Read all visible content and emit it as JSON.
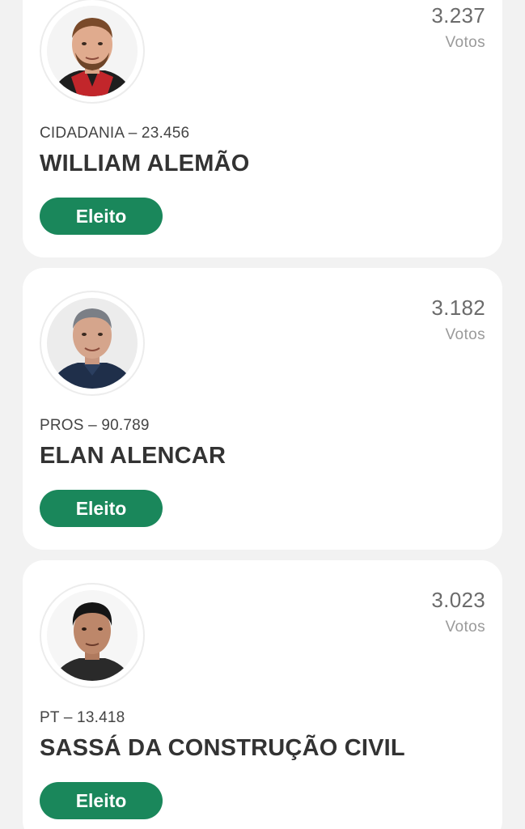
{
  "candidates": [
    {
      "votes": "3.237",
      "votes_label": "Votos",
      "party_number": "CIDADANIA – 23.456",
      "name": "WILLIAM ALEMÃO",
      "status": "Eleito",
      "status_color": "#1a875b"
    },
    {
      "votes": "3.182",
      "votes_label": "Votos",
      "party_number": "PROS – 90.789",
      "name": "ELAN ALENCAR",
      "status": "Eleito",
      "status_color": "#1a875b"
    },
    {
      "votes": "3.023",
      "votes_label": "Votos",
      "party_number": "PT – 13.418",
      "name": "SASSÁ DA CONSTRUÇÃO CIVIL",
      "status": "Eleito",
      "status_color": "#1a875b"
    }
  ]
}
